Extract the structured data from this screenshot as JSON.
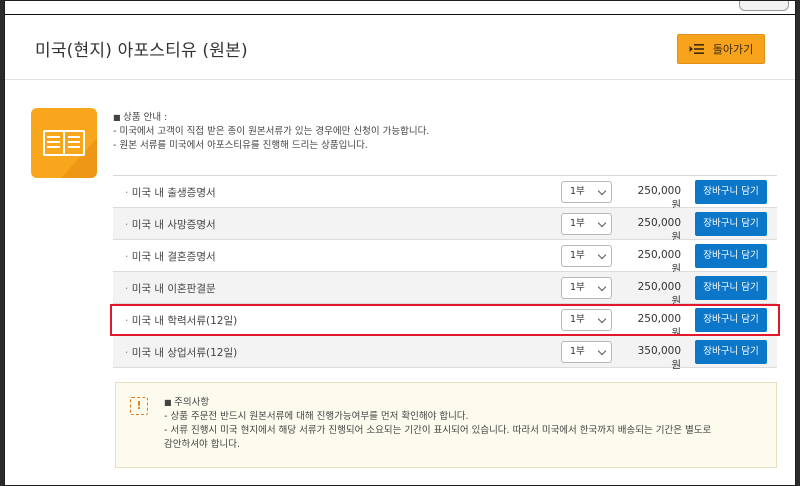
{
  "page": {
    "title": "미국(현지) 아포스티유 (원본)",
    "back_label": "돌아가기"
  },
  "info": {
    "heading": "상품 안내 :",
    "lines": [
      "- 미국에서 고객이 직접 받은 종이 원본서류가 있는 경우에만 신청이 가능합니다.",
      "- 원본 서류를 미국에서 아포스티유를 진행해 드리는 상품입니다."
    ]
  },
  "products": [
    {
      "name": "미국 내 출생증명서",
      "qty": "1부",
      "price": "250,000원",
      "cart_label": "장바구니 담기"
    },
    {
      "name": "미국 내 사망증명서",
      "qty": "1부",
      "price": "250,000원",
      "cart_label": "장바구니 담기"
    },
    {
      "name": "미국 내 결혼증명서",
      "qty": "1부",
      "price": "250,000원",
      "cart_label": "장바구니 담기"
    },
    {
      "name": "미국 내 이혼판결문",
      "qty": "1부",
      "price": "250,000원",
      "cart_label": "장바구니 담기"
    },
    {
      "name": "미국 내 학력서류(12일)",
      "qty": "1부",
      "price": "250,000원",
      "cart_label": "장바구니 담기"
    },
    {
      "name": "미국 내 상업서류(12일)",
      "qty": "1부",
      "price": "350,000원",
      "cart_label": "장바구니 담기"
    }
  ],
  "notice": {
    "icon": "exclamation-icon",
    "heading": "주의사항",
    "lines": [
      "- 상품 주문전 반드시 원본서류에 대해 진행가능여부를 먼저 확인해야 합니다.",
      "- 서류 진행시 미국 현지에서 해당 서류가 진행되어 소요되는 기간이 표시되어 있습니다. 따라서 미국에서 한국까지 배송되는 기간은 별도로",
      "  감안하셔야 합니다."
    ]
  },
  "colors": {
    "accent_orange": "#f7a41c",
    "cart_blue": "#0c76c8",
    "highlight_red": "#e3162a"
  }
}
